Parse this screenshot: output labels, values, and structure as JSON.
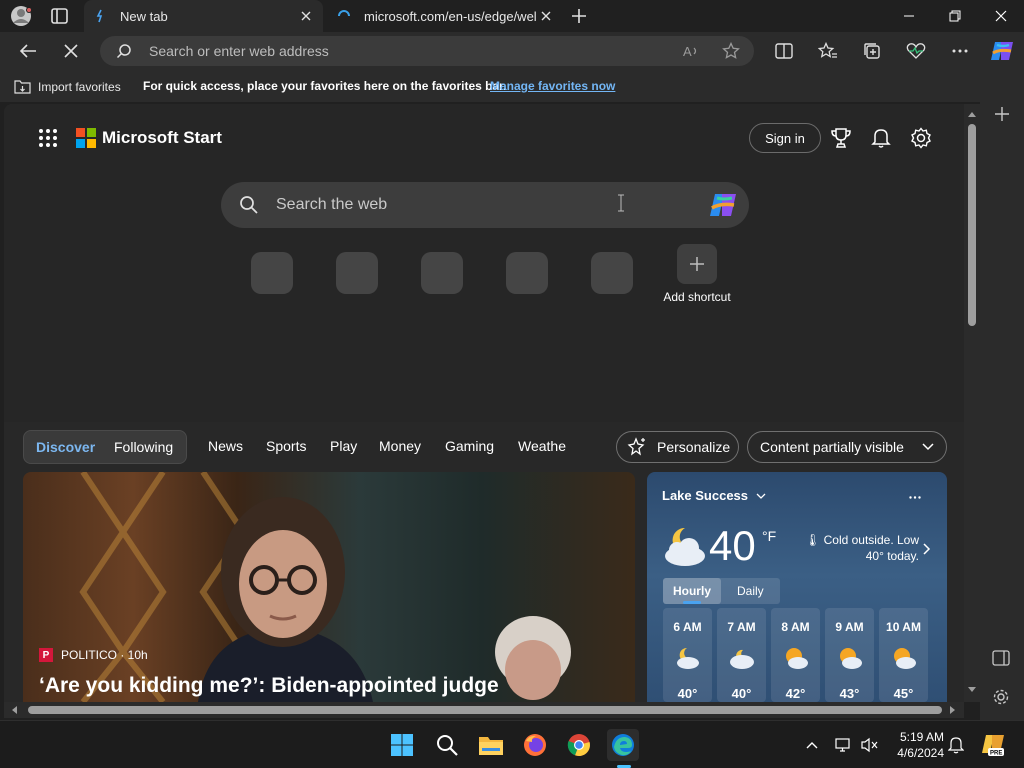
{
  "tabs": [
    {
      "title": "New tab",
      "active": true
    },
    {
      "title": "microsoft.com/en-us/edge/welc",
      "active": false
    }
  ],
  "address_bar": {
    "placeholder": "Search or enter web address"
  },
  "favorites_bar": {
    "import_label": "Import favorites",
    "hint": "For quick access, place your favorites here on the favorites bar.",
    "manage_link": "Manage favorites now"
  },
  "start_page": {
    "brand": "Microsoft Start",
    "sign_in": "Sign in",
    "search_placeholder": "Search the web",
    "add_shortcut": "Add shortcut"
  },
  "feed_nav": {
    "discover": "Discover",
    "following": "Following",
    "items": [
      "News",
      "Sports",
      "Play",
      "Money",
      "Gaming",
      "Weathe"
    ],
    "personalize": "Personalize",
    "content_visibility": "Content partially visible"
  },
  "hero": {
    "source": "POLITICO · 10h",
    "source_logo": "P",
    "headline": "‘Are you kidding me?’: Biden-appointed judge"
  },
  "weather": {
    "location": "Lake Success",
    "temperature": "40",
    "unit": "°F",
    "note": "Cold outside. Low 40° today.",
    "tab_hourly": "Hourly",
    "tab_daily": "Daily",
    "hours": [
      {
        "time": "6 AM",
        "temp": "40°",
        "icon": "moon-cloud"
      },
      {
        "time": "7 AM",
        "temp": "40°",
        "icon": "cloud"
      },
      {
        "time": "8 AM",
        "temp": "42°",
        "icon": "sun-cloud"
      },
      {
        "time": "9 AM",
        "temp": "43°",
        "icon": "sun-cloud"
      },
      {
        "time": "10 AM",
        "temp": "45°",
        "icon": "sun-cloud"
      }
    ]
  },
  "taskbar": {
    "time": "5:19 AM",
    "date": "4/6/2024"
  },
  "colors": {
    "accent_link": "#73b6f5",
    "edge_blue": "#0f7ddb",
    "politico_red": "#d4173b"
  }
}
